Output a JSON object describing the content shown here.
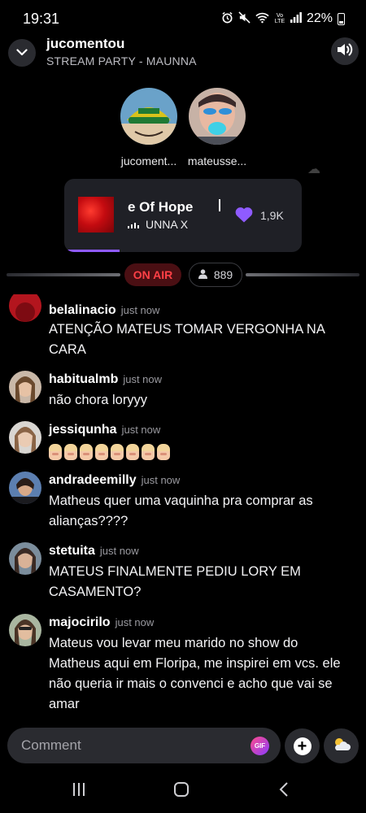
{
  "status_bar": {
    "time": "19:31",
    "network": "Vo LTE",
    "battery": "22%",
    "icons": [
      "alarm-icon",
      "mute-icon",
      "wifi-icon",
      "signal-icon",
      "battery-icon"
    ]
  },
  "header": {
    "title": "jucomentou",
    "subtitle": "STREAM PARTY - MAUNNA",
    "collapse_icon": "chevron-down-icon",
    "sound_icon": "speaker-icon"
  },
  "participants": [
    {
      "name": "jucoment..."
    },
    {
      "name": "mateusse..."
    }
  ],
  "now_playing": {
    "title": "e Of Hope",
    "artist": "UNNA X",
    "likes": "1,9K",
    "progress_fraction": 0.23,
    "colors": {
      "accent": "#8f5bff"
    }
  },
  "live": {
    "status": "ON AIR",
    "viewers": "889"
  },
  "chat": [
    {
      "user": "belalinacio",
      "time": "just now",
      "text": "ATENÇÃO MATEUS TOMAR VERGONHA NA CARA"
    },
    {
      "user": "habitualmb",
      "time": "just now",
      "text": "não chora loryyy"
    },
    {
      "user": "jessiqunha",
      "time": "just now",
      "text": "",
      "emoji_count": 8
    },
    {
      "user": "andradeemilly",
      "time": "just now",
      "text": "Matheus quer uma vaquinha pra comprar as alianças????"
    },
    {
      "user": "stetuita",
      "time": "just now",
      "text": "MATEUS FINALMENTE PEDIU LORY EM CASAMENTO?"
    },
    {
      "user": "majocirilo",
      "time": "just now",
      "text": "Mateus vou levar meu marido no show do Matheus aqui em Floripa, me inspirei em vcs. ele não queria ir mais o convenci e acho que vai se amar"
    }
  ],
  "composer": {
    "placeholder": "Comment",
    "gif_label": "GIF"
  },
  "colors": {
    "background": "#000000",
    "surface": "#2a2b30",
    "live_red": "#ff4046",
    "like_purple": "#8f5bff"
  }
}
